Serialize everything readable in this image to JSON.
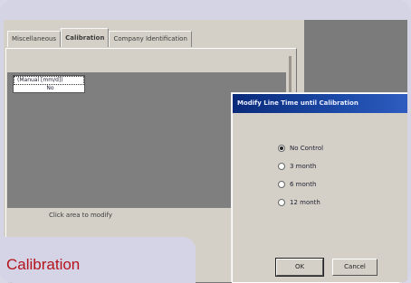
{
  "tabs": {
    "items": [
      {
        "label": "Miscellaneous"
      },
      {
        "label": "Calibration"
      },
      {
        "label": "Company Identification"
      }
    ],
    "active": "Calibration"
  },
  "list": {
    "rows": [
      "(Manual [mm/d])",
      "No"
    ]
  },
  "hint_text": "Click area to modify",
  "dialog": {
    "title": "Modify Line Time until Calibration",
    "options": [
      {
        "label": "No Control",
        "selected": true
      },
      {
        "label": "3 month",
        "selected": false
      },
      {
        "label": "6 month",
        "selected": false
      },
      {
        "label": "12 month",
        "selected": false
      }
    ],
    "ok_label": "OK",
    "cancel_label": "Cancel"
  },
  "caption": "Calibration",
  "colors": {
    "caption": "#b5121b",
    "title_bar": "#0a2a7a",
    "frame": "#d4d4e4"
  }
}
